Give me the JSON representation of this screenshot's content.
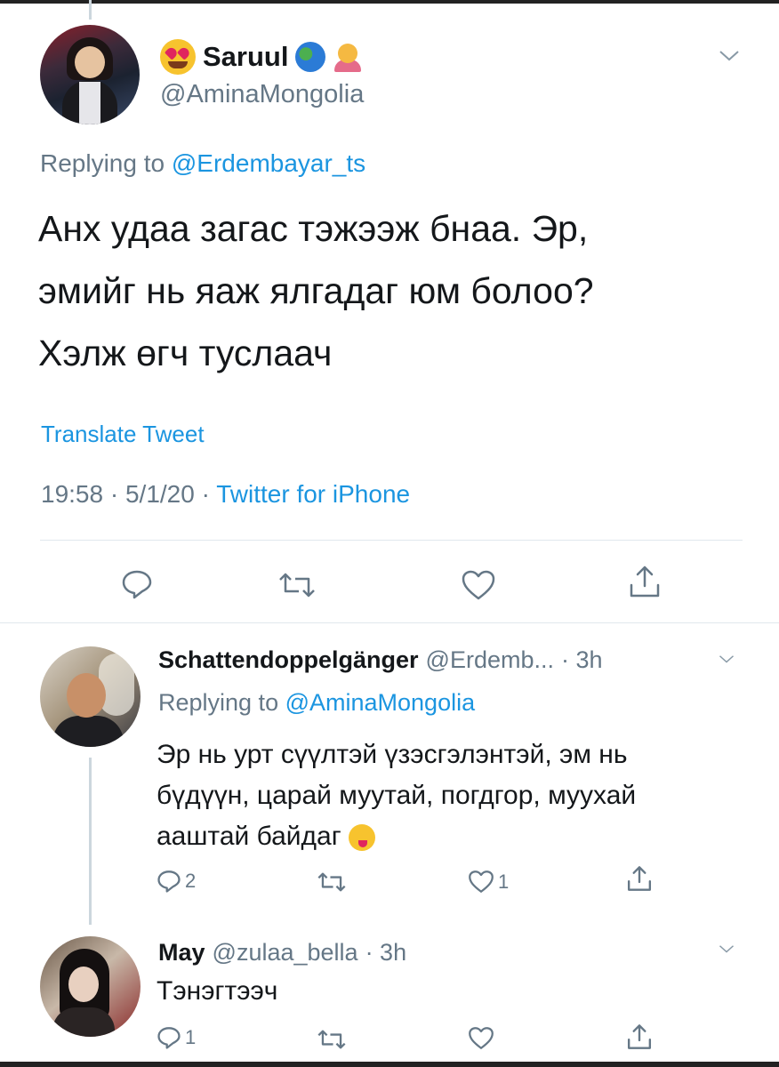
{
  "tweet": {
    "display_name": "Saruul",
    "handle": "@AminaMongolia",
    "replying_label": "Replying to ",
    "replying_handle": "@Erdembayar_ts",
    "text_lines": [
      "Анх удаа загас тэжээж бнаа. Эр,",
      "эмийг нь яаж ялгадаг юм болоо?",
      "Хэлж өгч туслаач"
    ],
    "translate_label": "Translate Tweet",
    "time": "19:58",
    "date": "5/1/20",
    "source": "Twitter for iPhone",
    "icons": [
      "smiling-heart-eyes-emoji",
      "globe-icon",
      "person-tipping-hand-emoji"
    ]
  },
  "replies": [
    {
      "display_name": "Schattendoppelgänger",
      "handle": "@Erdemb...",
      "time": "· 3h",
      "replying_label": "Replying to ",
      "replying_handle": "@AminaMongolia",
      "text_lines": [
        "Эр нь урт сүүлтэй үзэсгэлэнтэй, эм нь",
        "бүдүүн, царай муутай, погдгор, муухай",
        "ааштай байдаг"
      ],
      "emoji": "winking-face-with-tongue-emoji",
      "reply_count": "2",
      "like_count": "1"
    },
    {
      "display_name": "May",
      "handle": "@zulaa_bella",
      "time": "· 3h",
      "text": "Тэнэгтээч",
      "reply_count": "1"
    }
  ],
  "colors": {
    "link": "#1b95e0",
    "secondary": "#657786",
    "text": "#14171a",
    "divider": "#e1e8ed"
  }
}
